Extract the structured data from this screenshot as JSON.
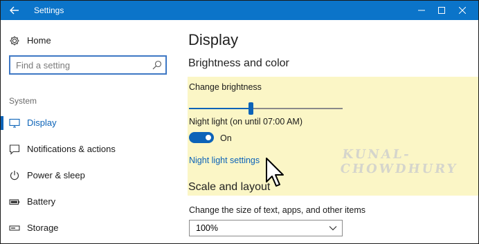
{
  "window": {
    "title": "Settings"
  },
  "sidebar": {
    "home_label": "Home",
    "search_placeholder": "Find a setting",
    "section_label": "System",
    "items": [
      {
        "label": "Display",
        "icon": "monitor-icon",
        "active": true
      },
      {
        "label": "Notifications & actions",
        "icon": "notification-icon",
        "active": false
      },
      {
        "label": "Power & sleep",
        "icon": "power-icon",
        "active": false
      },
      {
        "label": "Battery",
        "icon": "battery-icon",
        "active": false
      },
      {
        "label": "Storage",
        "icon": "storage-icon",
        "active": false
      }
    ]
  },
  "main": {
    "title": "Display",
    "brightness": {
      "heading": "Brightness and color",
      "slider_label": "Change brightness",
      "slider_value": 0.4,
      "night_light_label": "Night light (on until 07:00 AM)",
      "toggle_state": "On",
      "toggle_on": true,
      "link": "Night light settings"
    },
    "scale": {
      "heading": "Scale and layout",
      "label": "Change the size of text, apps, and other items",
      "selected": "100%"
    }
  },
  "watermark": "KUNAL-CHOWDHURY",
  "colors": {
    "accent": "#0c63b8",
    "titlebar": "#0b74c9",
    "highlight": "#fbf6c6"
  }
}
